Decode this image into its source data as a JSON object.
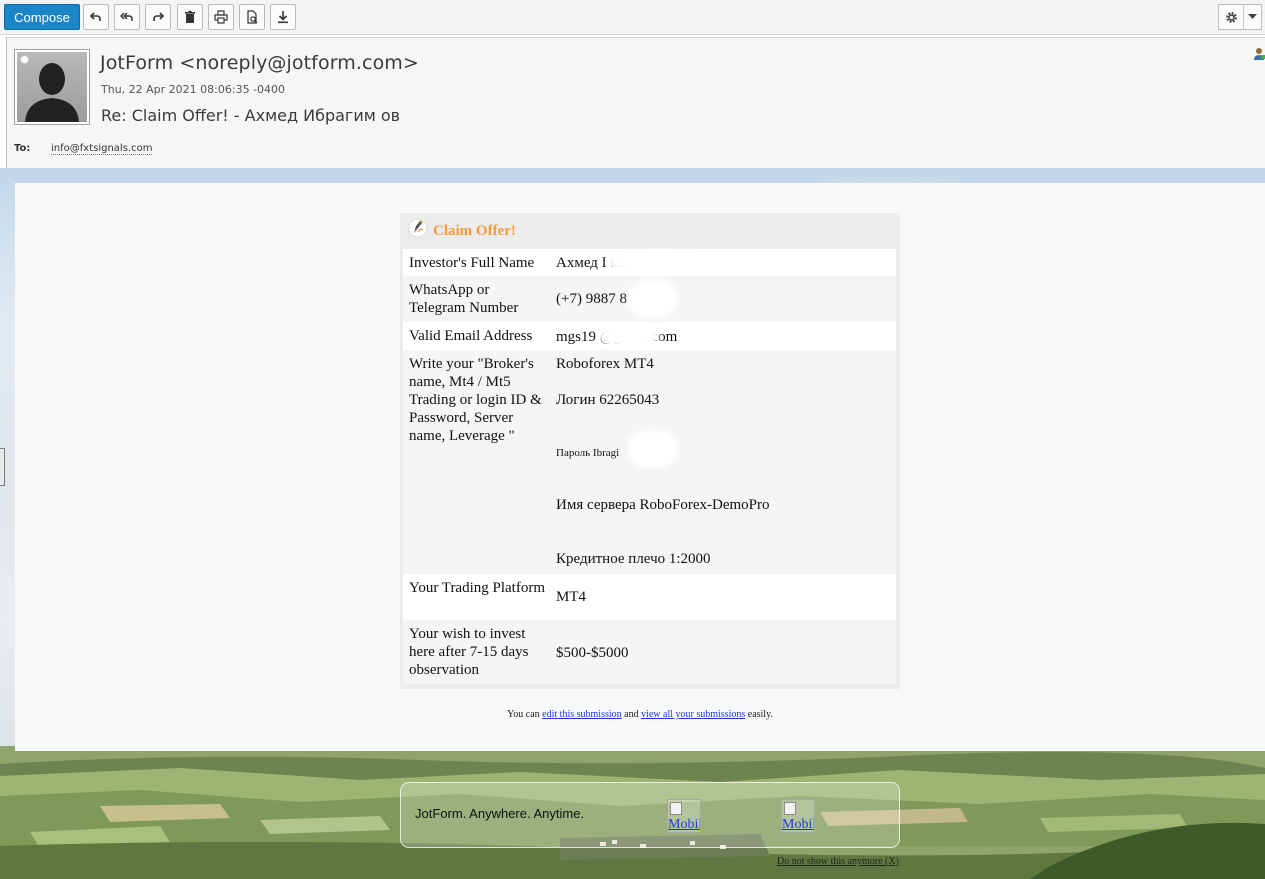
{
  "toolbar": {
    "compose_label": "Compose",
    "buttons": [
      "reply-icon",
      "reply-all-icon",
      "forward-icon",
      "delete-icon",
      "print-icon",
      "headers-icon",
      "download-icon"
    ],
    "settings_icon": "gear-icon"
  },
  "message": {
    "sender": "JotForm <noreply@jotform.com>",
    "date": "Thu, 22 Apr 2021 08:06:35 -0400",
    "subject": "Re: Claim Offer! - Ахмед Ибрагим ов",
    "to_label": "To:",
    "to_value": "info@fxtsignals.com"
  },
  "form": {
    "title": "Claim Offer!",
    "rows": [
      {
        "label": "Investor's Full Name",
        "value": "Ахмед I мов"
      },
      {
        "label": "WhatsApp or Telegram Number",
        "value": "(+7) 9887 8"
      },
      {
        "label": "Valid Email Address",
        "value": "mgs19 @gmail.com"
      },
      {
        "label": "Write your \"Broker's name, Mt4 / Mt5 Trading or login ID & Password, Server name, Leverage \"",
        "values": [
          "Roboforex MT4",
          "Логин 62265043",
          "Пароль Ibragi",
          "Имя сервера RoboForex-DemoPro",
          "Кредитное плечо 1:2000"
        ]
      },
      {
        "label": "Your Trading Platform",
        "value": "MT4"
      },
      {
        "label": "Your wish to invest here after 7-15 days observation",
        "value": "$500-$5000"
      }
    ]
  },
  "footer": {
    "prefix": "You can",
    "link1": "edit this submission",
    "middle": "and",
    "link2": "view all your submissions",
    "suffix": "easily."
  },
  "promo": {
    "text": "JotForm. Anywhere. Anytime.",
    "img1_alt": "Mobile",
    "img2_alt": "Mobile",
    "dismiss": "Do not show this anymore (X)"
  },
  "colors": {
    "compose_bg": "#1a86c8",
    "form_title": "#f49b38",
    "link": "#1f3bd6"
  }
}
